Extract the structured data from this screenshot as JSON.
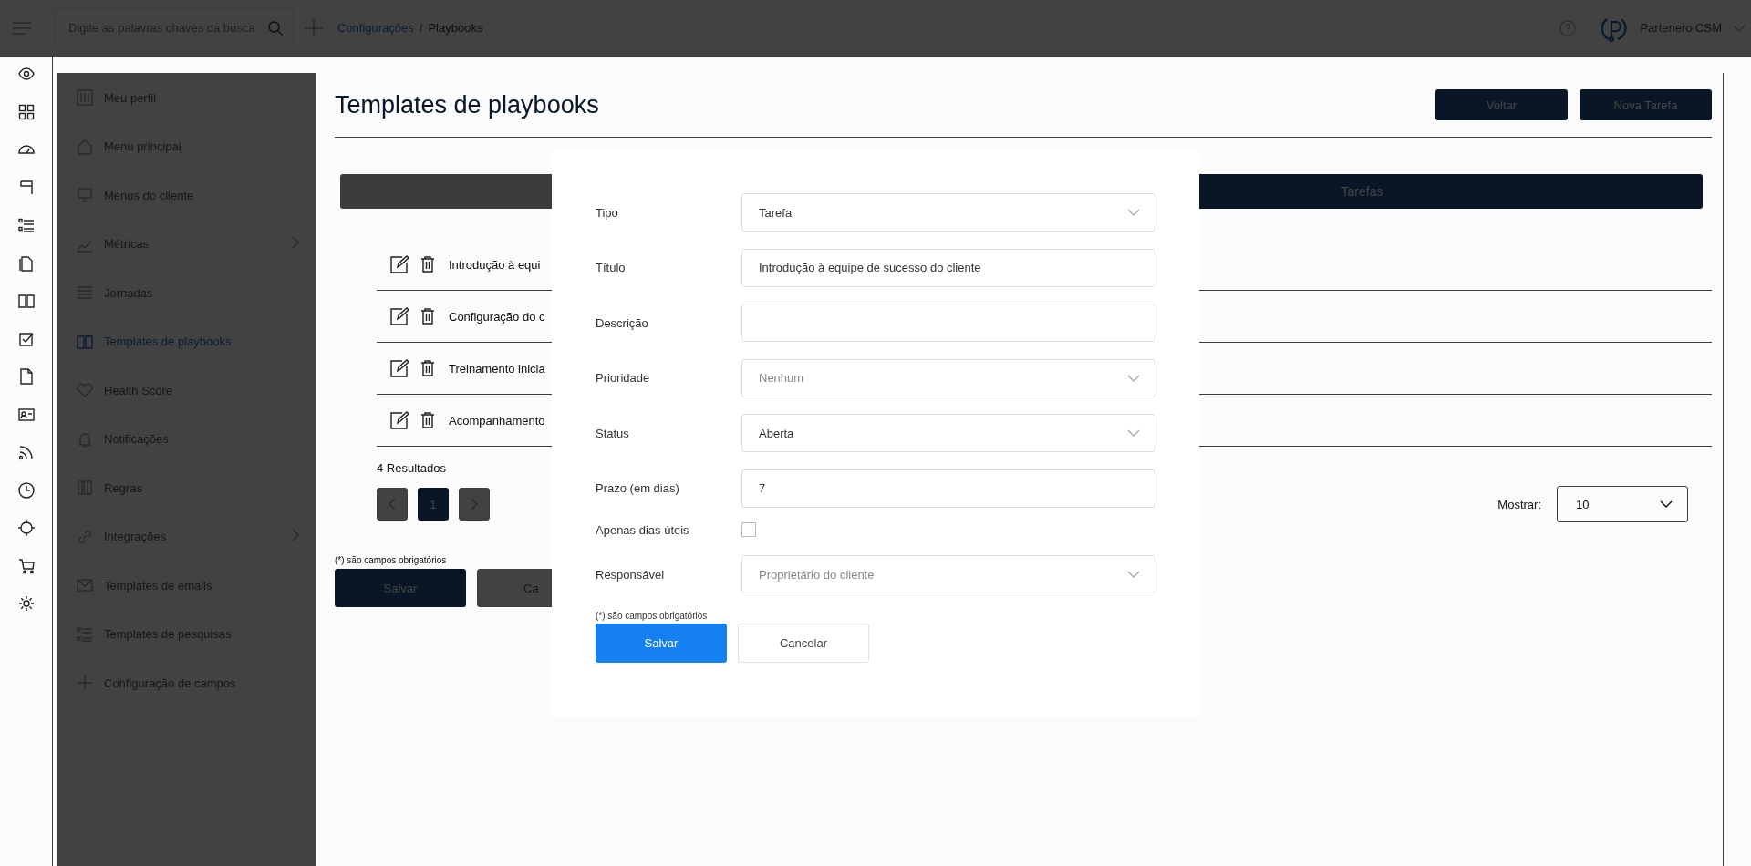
{
  "top_bar": {
    "search": {
      "placeholder": "Digite as palavras chaves da busca"
    },
    "breadcrumb": [
      "Configurações",
      "Playbooks"
    ],
    "breadcrumb_separator": "/",
    "user": "Partenero CSM"
  },
  "settings_menu": {
    "items": [
      {
        "label": "Meu perfil",
        "selected": false,
        "has_submenu": false
      },
      {
        "label": "Menu principal",
        "selected": false,
        "has_submenu": false
      },
      {
        "label": "Menus do cliente",
        "selected": false,
        "has_submenu": false
      },
      {
        "label": "Métricas",
        "selected": false,
        "has_submenu": true
      },
      {
        "label": "Jornadas",
        "selected": false,
        "has_submenu": false
      },
      {
        "label": "Templates de playbooks",
        "selected": true,
        "has_submenu": false
      },
      {
        "label": "Health Score",
        "selected": false,
        "has_submenu": false
      },
      {
        "label": "Notificações",
        "selected": false,
        "has_submenu": false
      },
      {
        "label": "Regras",
        "selected": false,
        "has_submenu": false
      },
      {
        "label": "Integrações",
        "selected": false,
        "has_submenu": true
      },
      {
        "label": "Templates de emails",
        "selected": false,
        "has_submenu": false
      },
      {
        "label": "Templates de pesquisas",
        "selected": false,
        "has_submenu": false
      },
      {
        "label": "Configuração de campos",
        "selected": false,
        "has_submenu": false
      }
    ]
  },
  "page": {
    "title": "Templates de playbooks",
    "buttons": [
      "Voltar",
      "Nova Tarefa"
    ],
    "tabs": [
      {
        "selected": false
      },
      {
        "label": "Tarefas",
        "selected": true
      }
    ],
    "rows": [
      {
        "title": "Introdução à equi"
      },
      {
        "title": "Configuração do c"
      },
      {
        "title": "Treinamento inicia"
      },
      {
        "title": "Acompanhamento"
      }
    ],
    "results": "4 Resultados",
    "pages": [
      {
        "label": "1",
        "selected": true
      }
    ],
    "page_size": {
      "label": "Mostrar:",
      "value": "10"
    },
    "required_note": "(*) são campos obrigatórios",
    "form_buttons": [
      "Salvar",
      "Ca"
    ]
  },
  "modal": {
    "fields": [
      {
        "kind": "select",
        "label": "Tipo",
        "value": "Tarefa"
      },
      {
        "kind": "text",
        "label": "Título",
        "value": "Introdução à equipe de sucesso do cliente"
      },
      {
        "kind": "text",
        "label": "Descrição"
      },
      {
        "kind": "select",
        "label": "Prioridade",
        "placeholder": "Nenhum"
      },
      {
        "kind": "select",
        "label": "Status",
        "value": "Aberta"
      },
      {
        "kind": "text",
        "label": "Prazo (em dias)",
        "value": "7"
      },
      {
        "kind": "checkbox",
        "label": "Apenas dias úteis",
        "checked": false
      },
      {
        "kind": "select",
        "label": "Responsável",
        "placeholder": "Proprietário do cliente"
      }
    ],
    "note": "(*) são campos obrigatórios",
    "buttons": [
      {
        "label": "Salvar",
        "kind": "primary"
      },
      {
        "label": "Cancelar",
        "kind": "secondary"
      }
    ]
  }
}
